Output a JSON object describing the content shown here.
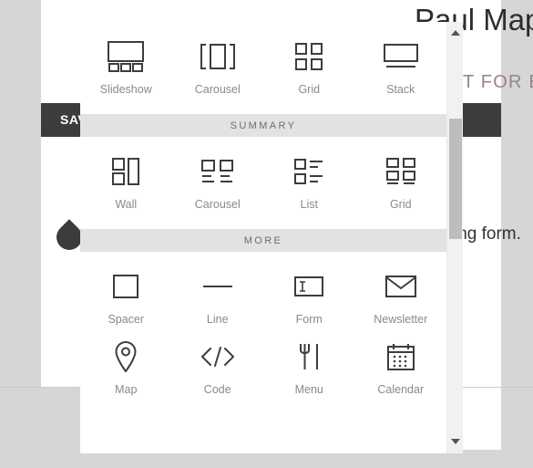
{
  "background": {
    "title": "Paul Map",
    "subtitle": "T FOR E",
    "save_bar_label": "SAV",
    "body_text": "ing form.",
    "drag_handle_name": "drag-handle"
  },
  "block_picker": {
    "sections": [
      {
        "header": null,
        "items": [
          {
            "label": "Slideshow",
            "icon": "slideshow-icon"
          },
          {
            "label": "Carousel",
            "icon": "carousel-icon"
          },
          {
            "label": "Grid",
            "icon": "grid-icon"
          },
          {
            "label": "Stack",
            "icon": "stack-icon"
          }
        ]
      },
      {
        "header": "SUMMARY",
        "items": [
          {
            "label": "Wall",
            "icon": "summary-wall-icon"
          },
          {
            "label": "Carousel",
            "icon": "summary-carousel-icon"
          },
          {
            "label": "List",
            "icon": "summary-list-icon"
          },
          {
            "label": "Grid",
            "icon": "summary-grid-icon"
          }
        ]
      },
      {
        "header": "MORE",
        "items": [
          {
            "label": "Spacer",
            "icon": "spacer-icon"
          },
          {
            "label": "Line",
            "icon": "line-icon"
          },
          {
            "label": "Form",
            "icon": "form-icon"
          },
          {
            "label": "Newsletter",
            "icon": "newsletter-icon"
          },
          {
            "label": "Map",
            "icon": "map-pin-icon"
          },
          {
            "label": "Code",
            "icon": "code-icon"
          },
          {
            "label": "Menu",
            "icon": "restaurant-menu-icon"
          },
          {
            "label": "Calendar",
            "icon": "calendar-icon"
          }
        ]
      }
    ],
    "scrollbar": {
      "up_arrow": "scroll-up-arrow",
      "down_arrow": "scroll-down-arrow",
      "thumb": "scroll-thumb"
    }
  },
  "colors": {
    "page_background": "#d6d6d6",
    "panel": "#ffffff",
    "dark_bar": "#3c3c3c",
    "section_header_bg": "#e2e2e2",
    "label_text": "#8a8a8a",
    "icon_stroke": "#3d3d3d",
    "subtitle_text": "#9c8386",
    "scrollbar_track": "#f1f1f1",
    "scrollbar_thumb": "#bdbdbd"
  }
}
